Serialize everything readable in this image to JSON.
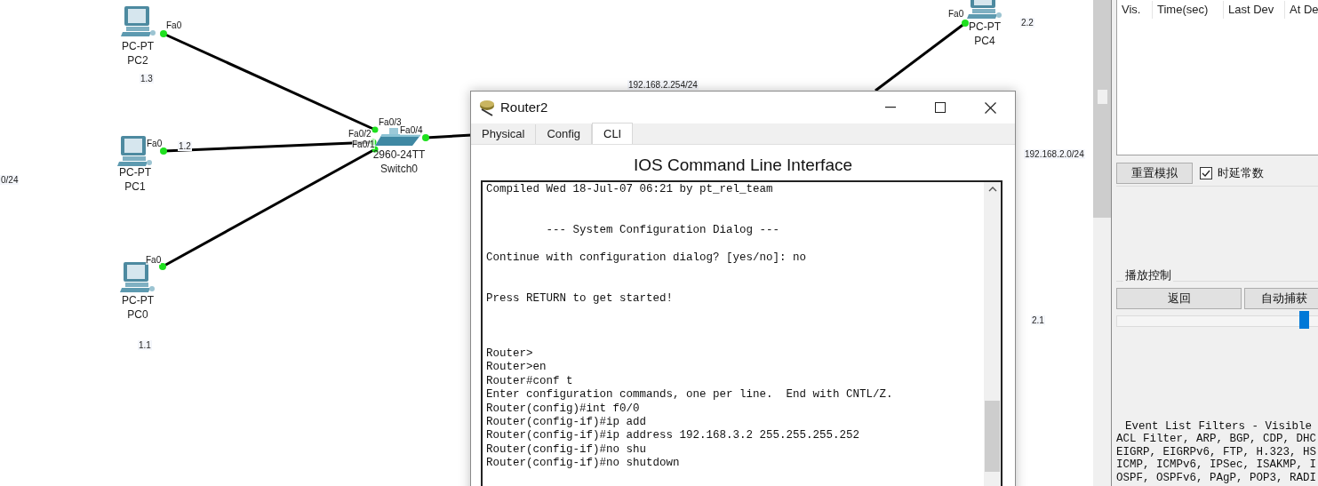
{
  "topology": {
    "devices": [
      {
        "kind": "pc",
        "model": "PC-PT",
        "name": "PC2"
      },
      {
        "kind": "pc",
        "model": "PC-PT",
        "name": "PC1"
      },
      {
        "kind": "pc",
        "model": "PC-PT",
        "name": "PC0"
      },
      {
        "kind": "switch",
        "model": "2960-24TT",
        "name": "Switch0"
      },
      {
        "kind": "pc",
        "model": "PC-PT",
        "name": "PC4"
      }
    ],
    "port_labels": [
      "Fa0",
      "Fa0",
      "Fa0",
      "Fa0/3",
      "Fa0/2",
      "Fa0/1",
      "Fa0/4",
      "Fa0"
    ],
    "address_labels": [
      "1.3",
      "1.2",
      "1.1",
      "2.2",
      "192.168.2.254/24",
      "192.168.2.0/24",
      "2.1",
      "0/24"
    ]
  },
  "router_window": {
    "title": "Router2",
    "tabs": [
      {
        "label": "Physical",
        "selected": false
      },
      {
        "label": "Config",
        "selected": false
      },
      {
        "label": "CLI",
        "selected": true
      }
    ],
    "heading": "IOS Command Line Interface",
    "terminal_text": "Compiled Wed 18-Jul-07 06:21 by pt_rel_team\n\n\n         --- System Configuration Dialog ---\n\nContinue with configuration dialog? [yes/no]: no\n\n\nPress RETURN to get started!\n\n\n\nRouter>\nRouter>en\nRouter#conf t\nEnter configuration commands, one per line.  End with CNTL/Z.\nRouter(config)#int f0/0\nRouter(config-if)#ip add\nRouter(config-if)#ip address 192.168.3.2 255.255.255.252\nRouter(config-if)#no shu\nRouter(config-if)#no shutdown"
  },
  "simulation_panel": {
    "event_columns": [
      "Vis.",
      "Time(sec)",
      "Last Dev",
      "At De"
    ],
    "reset_button": "重置模拟",
    "constant_delay": {
      "label": "时延常数",
      "checked": true
    },
    "playback_group": "播放控制",
    "playback_buttons": [
      "返回",
      "自动捕获"
    ],
    "speed_slider": {
      "level": 0.88
    },
    "filters_title": "Event List Filters - Visible",
    "filter_lines": [
      "ACL Filter, ARP, BGP, CDP, DHC",
      "EIGRP, EIGRPv6, FTP, H.323, HS",
      "ICMP, ICMPv6, IPSec, ISAKMP, I",
      "OSPF, OSPFv6, PAgP, POP3, RADI"
    ]
  }
}
